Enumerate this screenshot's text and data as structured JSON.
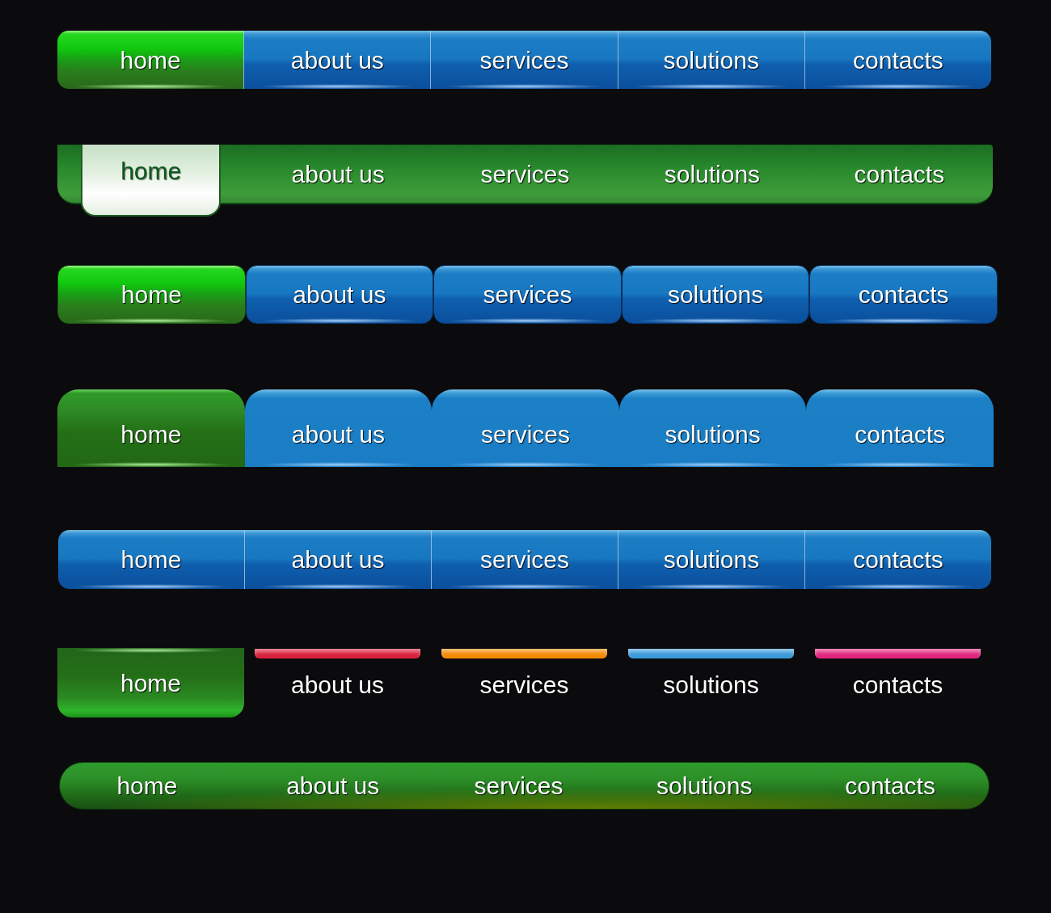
{
  "menus": [
    {
      "kind": "segmented",
      "items": [
        {
          "label": "home",
          "selected": true
        },
        {
          "label": "about us",
          "selected": false
        },
        {
          "label": "services",
          "selected": false
        },
        {
          "label": "solutions",
          "selected": false
        },
        {
          "label": "contacts",
          "selected": false
        }
      ]
    },
    {
      "kind": "hanging-tab",
      "items": [
        {
          "label": "home",
          "selected": true
        },
        {
          "label": "about us",
          "selected": false
        },
        {
          "label": "services",
          "selected": false
        },
        {
          "label": "solutions",
          "selected": false
        },
        {
          "label": "contacts",
          "selected": false
        }
      ]
    },
    {
      "kind": "separate-tabs",
      "items": [
        {
          "label": "home",
          "selected": true
        },
        {
          "label": "about us",
          "selected": false
        },
        {
          "label": "services",
          "selected": false
        },
        {
          "label": "solutions",
          "selected": false
        },
        {
          "label": "contacts",
          "selected": false
        }
      ]
    },
    {
      "kind": "folder-tabs",
      "items": [
        {
          "label": "home",
          "selected": true
        },
        {
          "label": "about us",
          "selected": false
        },
        {
          "label": "services",
          "selected": false
        },
        {
          "label": "solutions",
          "selected": false
        },
        {
          "label": "contacts",
          "selected": false
        }
      ]
    },
    {
      "kind": "segmented",
      "items": [
        {
          "label": "home",
          "selected": false
        },
        {
          "label": "about us",
          "selected": false
        },
        {
          "label": "services",
          "selected": false
        },
        {
          "label": "solutions",
          "selected": false
        },
        {
          "label": "contacts",
          "selected": false
        }
      ]
    },
    {
      "kind": "indicator-tabs",
      "items": [
        {
          "label": "home",
          "selected": true
        },
        {
          "label": "about us",
          "selected": false,
          "color": "#d8213c"
        },
        {
          "label": "services",
          "selected": false,
          "color": "#f28a05"
        },
        {
          "label": "solutions",
          "selected": false,
          "color": "#3a9ad8"
        },
        {
          "label": "contacts",
          "selected": false,
          "color": "#e0267e"
        }
      ]
    },
    {
      "kind": "pill",
      "items": [
        {
          "label": "home",
          "selected": false
        },
        {
          "label": "about us",
          "selected": false
        },
        {
          "label": "services",
          "selected": false
        },
        {
          "label": "solutions",
          "selected": false
        },
        {
          "label": "contacts",
          "selected": false
        }
      ]
    }
  ]
}
